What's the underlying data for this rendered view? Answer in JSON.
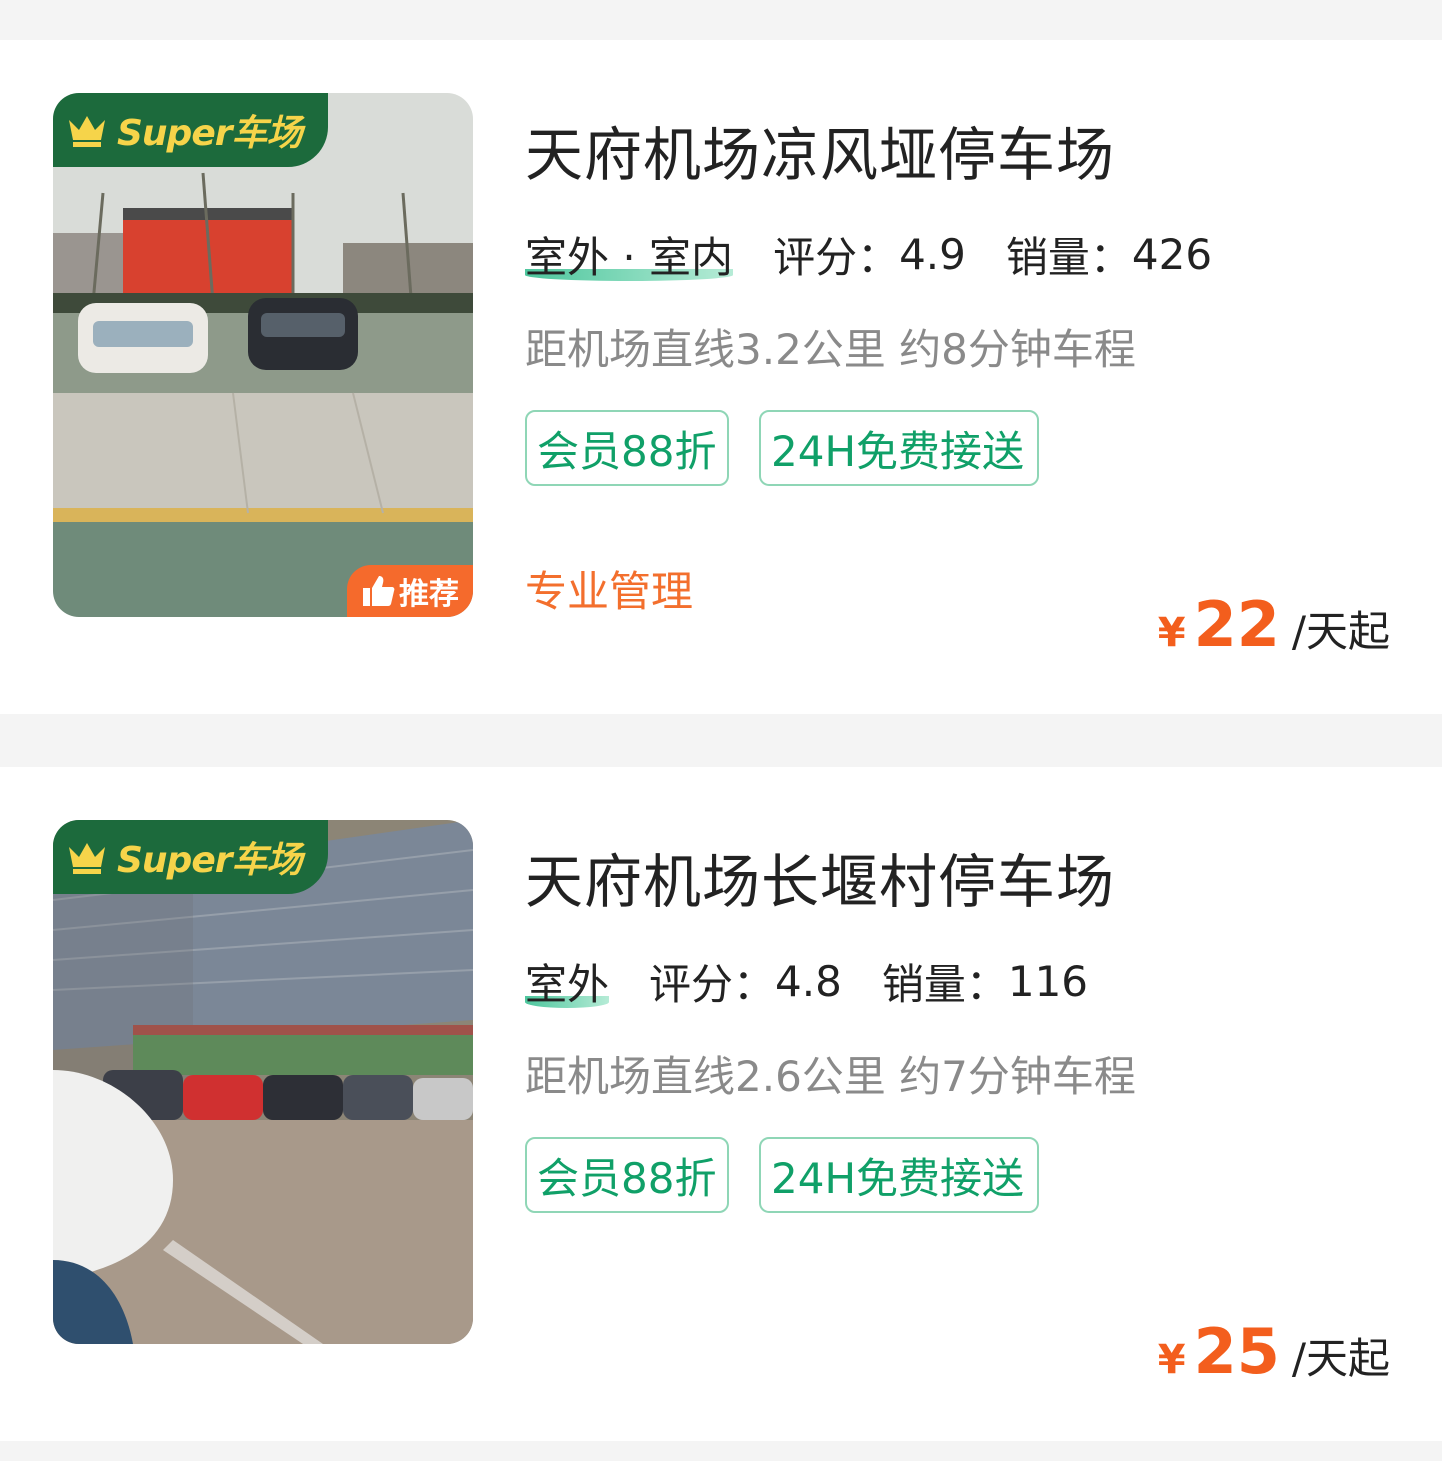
{
  "listings": [
    {
      "super_badge": "Super车场",
      "recommend_badge": "推荐",
      "title": "天府机场凉风垭停车场",
      "environment": "室外 · 室内",
      "rating_label": "评分：",
      "rating": "4.9",
      "sales_label": "销量：",
      "sales": "426",
      "distance": "距机场直线3.2公里 约8分钟车程",
      "tags": [
        "会员88折",
        "24H免费接送"
      ],
      "feature": "专业管理",
      "currency": "¥",
      "price": "22",
      "price_unit": "/天起"
    },
    {
      "super_badge": "Super车场",
      "title": "天府机场长堰村停车场",
      "environment": "室外",
      "rating_label": "评分：",
      "rating": "4.8",
      "sales_label": "销量：",
      "sales": "116",
      "distance": "距机场直线2.6公里 约7分钟车程",
      "tags": [
        "会员88折",
        "24H免费接送"
      ],
      "currency": "¥",
      "price": "25",
      "price_unit": "/天起"
    }
  ],
  "colors": {
    "brand_green": "#1c6a3c",
    "badge_gold": "#f6d44a",
    "tag_green": "#10a068",
    "accent_orange": "#f35e1d"
  }
}
